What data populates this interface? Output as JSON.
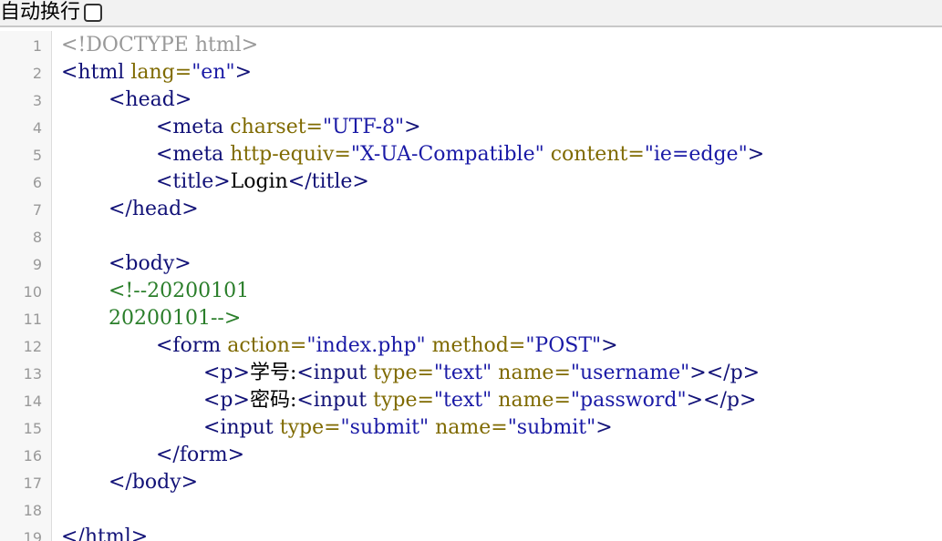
{
  "toolbar": {
    "wrap_label": "自动换行"
  },
  "lines": [
    {
      "n": "1",
      "indent": 0,
      "tokens": [
        {
          "t": "doc",
          "v": "<!DOCTYPE html>"
        }
      ]
    },
    {
      "n": "2",
      "indent": 0,
      "tokens": [
        {
          "t": "tag",
          "v": "<html"
        },
        {
          "t": "txt",
          "v": " "
        },
        {
          "t": "attr",
          "v": "lang="
        },
        {
          "t": "str",
          "v": "\"en\""
        },
        {
          "t": "tag",
          "v": ">"
        }
      ]
    },
    {
      "n": "3",
      "indent": 1,
      "tokens": [
        {
          "t": "tag",
          "v": "<head>"
        }
      ]
    },
    {
      "n": "4",
      "indent": 2,
      "tokens": [
        {
          "t": "tag",
          "v": "<meta"
        },
        {
          "t": "txt",
          "v": " "
        },
        {
          "t": "attr",
          "v": "charset="
        },
        {
          "t": "str",
          "v": "\"UTF-8\""
        },
        {
          "t": "tag",
          "v": ">"
        }
      ]
    },
    {
      "n": "5",
      "indent": 2,
      "tokens": [
        {
          "t": "tag",
          "v": "<meta"
        },
        {
          "t": "txt",
          "v": " "
        },
        {
          "t": "attr",
          "v": "http-equiv="
        },
        {
          "t": "str",
          "v": "\"X-UA-Compatible\""
        },
        {
          "t": "txt",
          "v": " "
        },
        {
          "t": "attr",
          "v": "content="
        },
        {
          "t": "str",
          "v": "\"ie=edge\""
        },
        {
          "t": "tag",
          "v": ">"
        }
      ]
    },
    {
      "n": "6",
      "indent": 2,
      "tokens": [
        {
          "t": "tag",
          "v": "<title>"
        },
        {
          "t": "txt",
          "v": "Login"
        },
        {
          "t": "tag",
          "v": "</title>"
        }
      ]
    },
    {
      "n": "7",
      "indent": 1,
      "tokens": [
        {
          "t": "tag",
          "v": "</head>"
        }
      ]
    },
    {
      "n": "8",
      "indent": 0,
      "tokens": []
    },
    {
      "n": "9",
      "indent": 1,
      "tokens": [
        {
          "t": "tag",
          "v": "<body>"
        }
      ]
    },
    {
      "n": "10",
      "indent": 1,
      "tokens": [
        {
          "t": "com",
          "v": "<!--20200101"
        }
      ]
    },
    {
      "n": "11",
      "indent": 1,
      "tokens": [
        {
          "t": "com",
          "v": "20200101-->"
        }
      ]
    },
    {
      "n": "12",
      "indent": 2,
      "tokens": [
        {
          "t": "tag",
          "v": "<form"
        },
        {
          "t": "txt",
          "v": " "
        },
        {
          "t": "attr",
          "v": "action="
        },
        {
          "t": "str",
          "v": "\"index.php\""
        },
        {
          "t": "txt",
          "v": " "
        },
        {
          "t": "attr",
          "v": "method="
        },
        {
          "t": "str",
          "v": "\"POST\""
        },
        {
          "t": "tag",
          "v": ">"
        }
      ]
    },
    {
      "n": "13",
      "indent": 3,
      "tokens": [
        {
          "t": "tag",
          "v": "<p>"
        },
        {
          "t": "txt",
          "v": "学号:"
        },
        {
          "t": "tag",
          "v": "<input"
        },
        {
          "t": "txt",
          "v": " "
        },
        {
          "t": "attr",
          "v": "type="
        },
        {
          "t": "str",
          "v": "\"text\""
        },
        {
          "t": "txt",
          "v": " "
        },
        {
          "t": "attr",
          "v": "name="
        },
        {
          "t": "str",
          "v": "\"username\""
        },
        {
          "t": "tag",
          "v": "></p>"
        }
      ]
    },
    {
      "n": "14",
      "indent": 3,
      "tokens": [
        {
          "t": "tag",
          "v": "<p>"
        },
        {
          "t": "txt",
          "v": "密码:"
        },
        {
          "t": "tag",
          "v": "<input"
        },
        {
          "t": "txt",
          "v": " "
        },
        {
          "t": "attr",
          "v": "type="
        },
        {
          "t": "str",
          "v": "\"text\""
        },
        {
          "t": "txt",
          "v": " "
        },
        {
          "t": "attr",
          "v": "name="
        },
        {
          "t": "str",
          "v": "\"password\""
        },
        {
          "t": "tag",
          "v": "></p>"
        }
      ]
    },
    {
      "n": "15",
      "indent": 3,
      "tokens": [
        {
          "t": "tag",
          "v": "<input"
        },
        {
          "t": "txt",
          "v": " "
        },
        {
          "t": "attr",
          "v": "type="
        },
        {
          "t": "str",
          "v": "\"submit\""
        },
        {
          "t": "txt",
          "v": " "
        },
        {
          "t": "attr",
          "v": "name="
        },
        {
          "t": "str",
          "v": "\"submit\""
        },
        {
          "t": "tag",
          "v": ">"
        }
      ]
    },
    {
      "n": "16",
      "indent": 2,
      "tokens": [
        {
          "t": "tag",
          "v": "</form>"
        }
      ]
    },
    {
      "n": "17",
      "indent": 1,
      "tokens": [
        {
          "t": "tag",
          "v": "</body>"
        }
      ]
    },
    {
      "n": "18",
      "indent": 0,
      "tokens": []
    },
    {
      "n": "19",
      "indent": 0,
      "tokens": [
        {
          "t": "tag",
          "v": "</html>"
        }
      ]
    }
  ]
}
